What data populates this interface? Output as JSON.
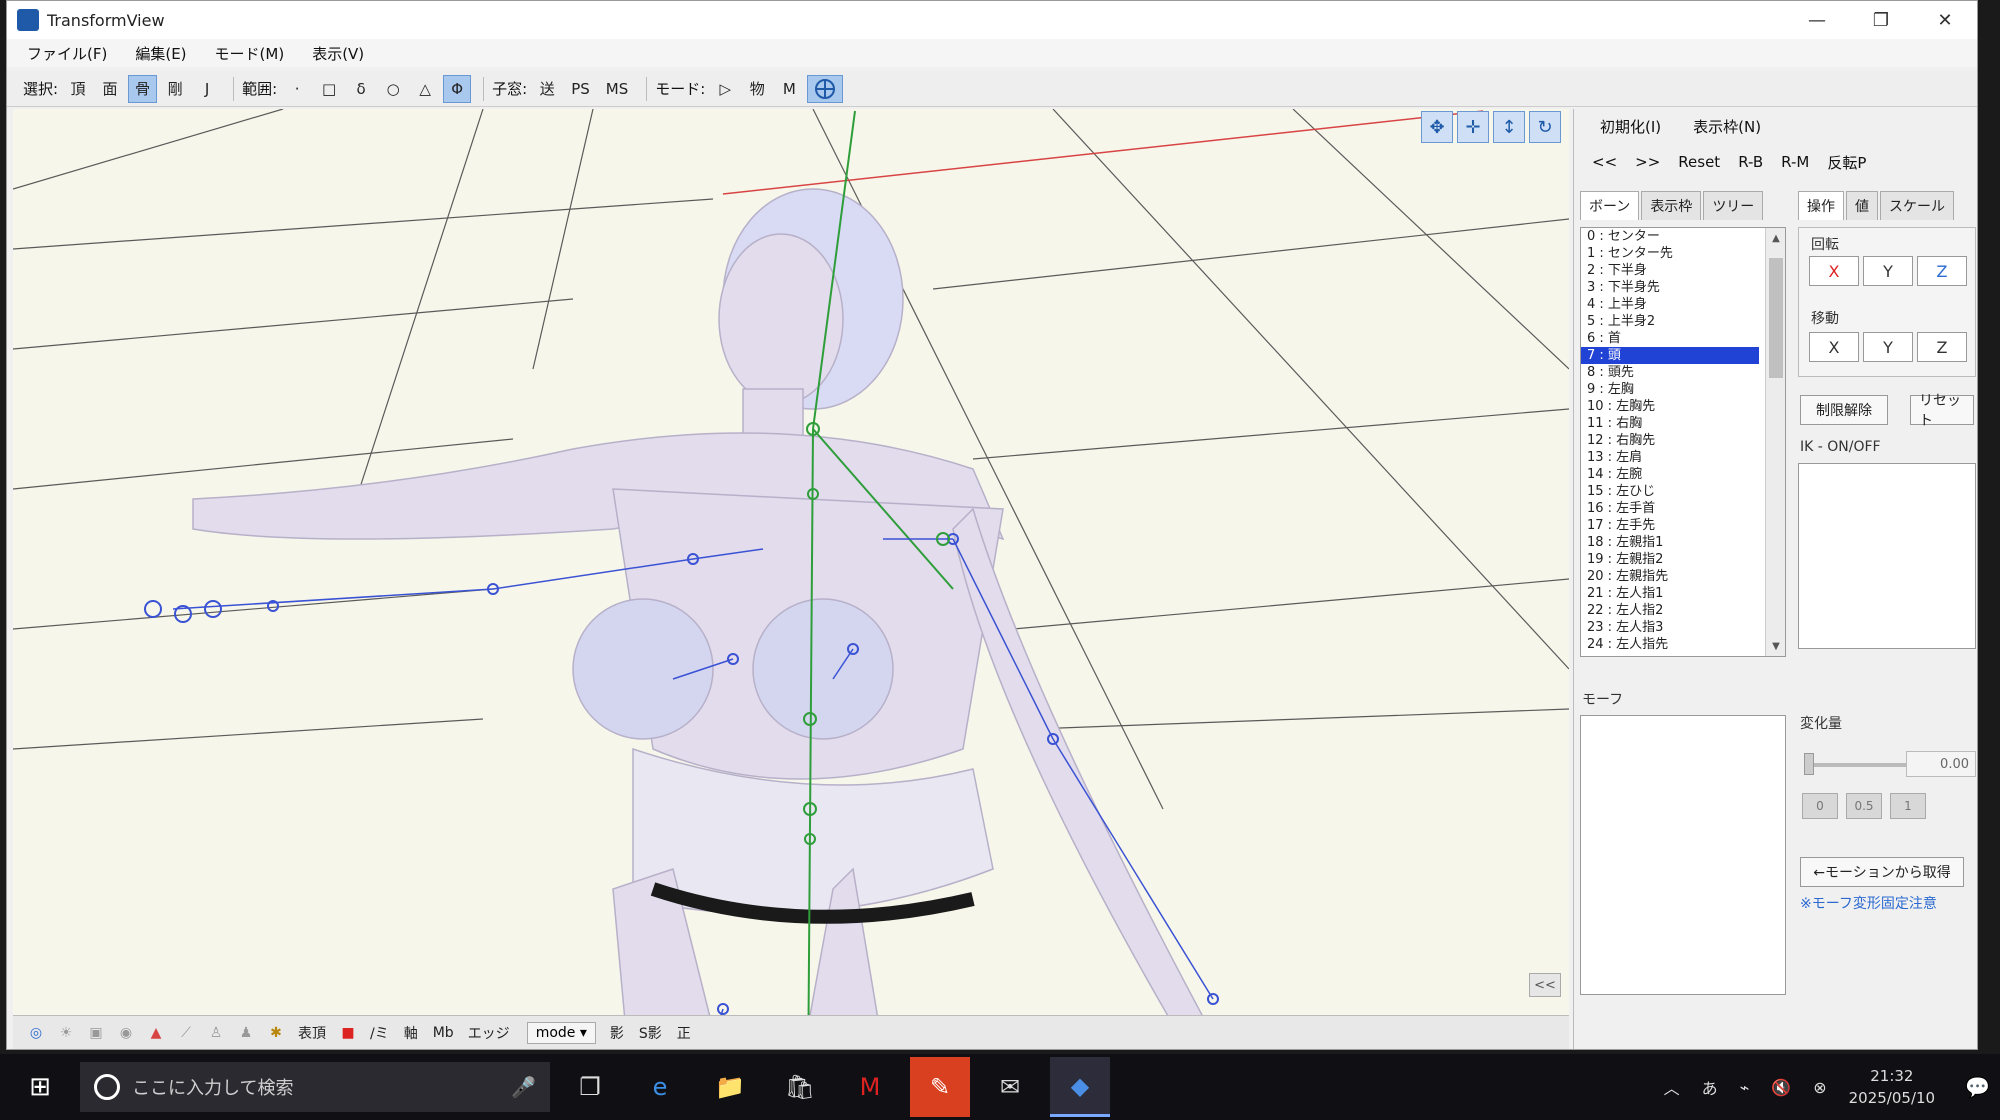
{
  "window": {
    "title": "TransformView",
    "controls": {
      "minimize": "—",
      "maximize": "❐",
      "close": "✕"
    }
  },
  "menu": [
    "ファイル(F)",
    "編集(E)",
    "モード(M)",
    "表示(V)"
  ],
  "toolbar": {
    "select_label": "選択:",
    "select_items": [
      "頂",
      "面",
      "骨",
      "剛",
      "J"
    ],
    "range_label": "範囲:",
    "range_items": [
      "·",
      "□",
      "δ",
      "○",
      "△",
      "Φ"
    ],
    "child_label": "子窓:",
    "child_items": [
      "送",
      "PS",
      "MS"
    ],
    "mode_label": "モード:",
    "mode_items": [
      "▷",
      "物",
      "M"
    ]
  },
  "viewport_tools": [
    "move-xy",
    "move-all",
    "move-z",
    "rotate"
  ],
  "viewport_collapse": "<<",
  "bottom_bar": {
    "items": [
      "表頂",
      "■",
      "/ミ",
      "軸",
      "Mb",
      "エッジ"
    ],
    "mode_select": "mode ▾",
    "tail": [
      "影",
      "S影",
      "正"
    ]
  },
  "panel": {
    "top_menu": [
      "初期化(I)",
      "表示枠(N)"
    ],
    "nav": [
      "<<",
      ">>",
      "Reset",
      "R-B",
      "R-M",
      "反転P"
    ],
    "left_tabs": [
      "ボーン",
      "表示枠",
      "ツリー"
    ],
    "right_tabs": [
      "操作",
      "値",
      "スケール"
    ],
    "bones": [
      "0 : センター",
      "1 : センター先",
      "2 : 下半身",
      "3 : 下半身先",
      "4 : 上半身",
      "5 : 上半身2",
      "6 : 首",
      "7 : 頭",
      "8 : 頭先",
      "9 : 左胸",
      "10 : 左胸先",
      "11 : 右胸",
      "12 : 右胸先",
      "13 : 左肩",
      "14 : 左腕",
      "15 : 左ひじ",
      "16 : 左手首",
      "17 : 左手先",
      "18 : 左親指1",
      "19 : 左親指2",
      "20 : 左親指先",
      "21 : 左人指1",
      "22 : 左人指2",
      "23 : 左人指3",
      "24 : 左人指先"
    ],
    "selected_bone_index": 7,
    "rotate_label": "回転",
    "move_label": "移動",
    "axes": [
      "X",
      "Y",
      "Z"
    ],
    "unlimit_button": "制限解除",
    "reset_button": "リセット",
    "ik_label": "IK - ON/OFF",
    "morph_label": "モーフ",
    "change_label": "変化量",
    "change_value": "0.00",
    "preset_buttons": [
      "0",
      "0.5",
      "1"
    ],
    "from_motion_button": "←モーションから取得",
    "note": "※モーフ変形固定注意"
  },
  "taskbar": {
    "search_placeholder": "ここに入力して検索",
    "time": "21:32",
    "date": "2025/05/10"
  }
}
